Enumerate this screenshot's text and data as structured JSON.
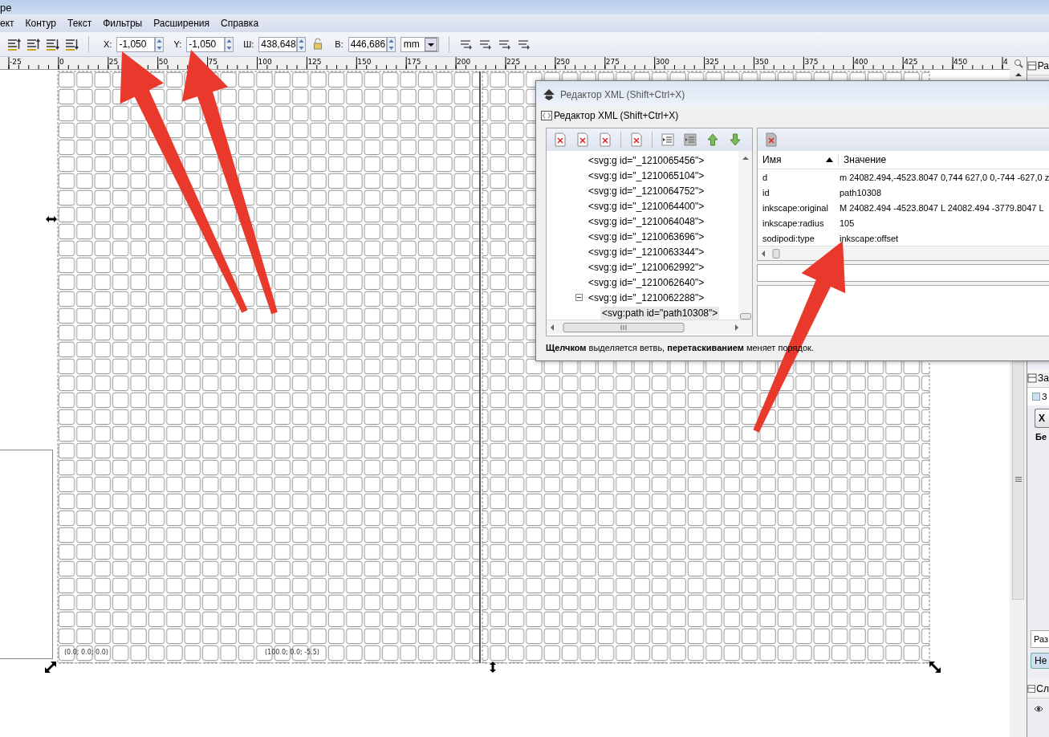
{
  "window": {
    "title": "pe"
  },
  "menu": [
    {
      "label": "ект"
    },
    {
      "label": "Контур"
    },
    {
      "label": "Текст"
    },
    {
      "label": "Фильтры"
    },
    {
      "label": "Расширения"
    },
    {
      "label": "Справка"
    }
  ],
  "toolbar": {
    "fields": [
      {
        "label": "X:",
        "value": "-1,050"
      },
      {
        "label": "Y:",
        "value": "-1,050"
      },
      {
        "label": "Ш:",
        "value": "438,648"
      },
      {
        "label": "В:",
        "value": "446,686"
      }
    ],
    "unit": "mm"
  },
  "ruler": {
    "labels": [
      "-25",
      "0",
      "25",
      "50",
      "75",
      "100",
      "125",
      "150",
      "175",
      "200",
      "225",
      "250",
      "275",
      "300",
      "325",
      "350",
      "375",
      "400",
      "425",
      "450",
      "4"
    ]
  },
  "canvas": {
    "coordinate_labels": [
      "(0.0; 0.0; 0.0)",
      "(100.0; 0.0; -5.5)"
    ]
  },
  "xml_editor": {
    "title": "Редактор XML (Shift+Ctrl+X)",
    "panel_title": "Редактор XML (Shift+Ctrl+X)",
    "nodes": [
      {
        "label": "<svg:g id=\"_1210065456\">",
        "selected": false
      },
      {
        "label": "<svg:g id=\"_1210065104\">",
        "selected": false
      },
      {
        "label": "<svg:g id=\"_1210064752\">",
        "selected": false
      },
      {
        "label": "<svg:g id=\"_1210064400\">",
        "selected": false
      },
      {
        "label": "<svg:g id=\"_1210064048\">",
        "selected": false
      },
      {
        "label": "<svg:g id=\"_1210063696\">",
        "selected": false
      },
      {
        "label": "<svg:g id=\"_1210063344\">",
        "selected": false
      },
      {
        "label": "<svg:g id=\"_1210062992\">",
        "selected": false
      },
      {
        "label": "<svg:g id=\"_1210062640\">",
        "selected": false
      },
      {
        "label": "<svg:g id=\"_1210062288\">",
        "selected": false,
        "expanded": true,
        "children": [
          {
            "label": "<svg:path id=\"path10308\">",
            "selected": true
          }
        ]
      }
    ],
    "attribute_columns": [
      "Имя",
      "Значение"
    ],
    "attributes": [
      {
        "name": "d",
        "value": "m 24082.494,-4523.8047 0,744 627,0 0,-744 -627,0 z"
      },
      {
        "name": "id",
        "value": "path10308"
      },
      {
        "name": "inkscape:original",
        "value": "M 24082.494 -4523.8047 L 24082.494 -3779.8047 L"
      },
      {
        "name": "inkscape:radius",
        "value": "105"
      },
      {
        "name": "sodipodi:type",
        "value": "inkscape:offset"
      }
    ],
    "status": "**Щелчком** выделяется ветвь, **перетаскиванием** меняет порядок."
  },
  "dock": [
    {
      "kind": "tab",
      "label": "Ра"
    },
    {
      "kind": "tab",
      "label": "За"
    },
    {
      "kind": "checkbox",
      "label": "З",
      "checked": false
    },
    {
      "kind": "button",
      "label": "Х"
    },
    {
      "kind": "heading",
      "label": "Бе"
    },
    {
      "kind": "field",
      "label": "Раз"
    },
    {
      "kind": "button",
      "label": "Не"
    },
    {
      "kind": "tab",
      "label": "Сл"
    }
  ]
}
